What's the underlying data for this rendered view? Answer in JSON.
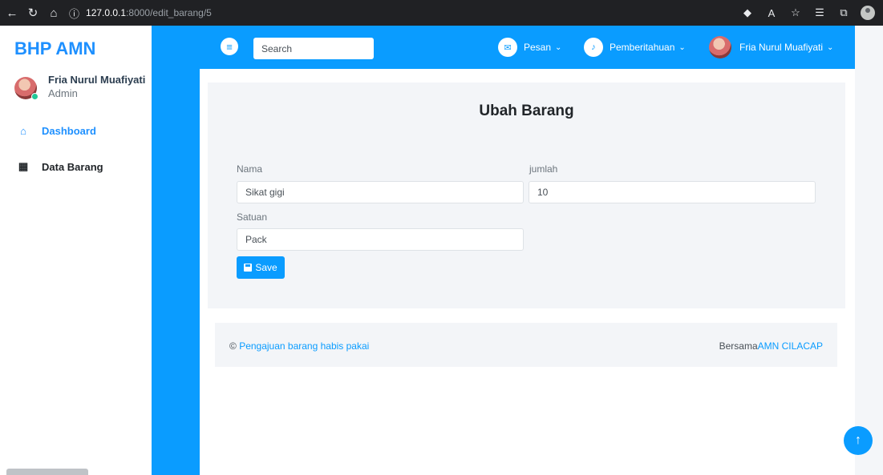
{
  "browser": {
    "back_icon": "←",
    "refresh_icon": "↻",
    "home_icon": "⌂",
    "info_icon": "ⓘ",
    "url_host": "127.0.0.1",
    "url_path": ":8000/edit_barang/5"
  },
  "sidebar": {
    "brand": "BHP AMN",
    "user_name": "Fria Nurul Muafiyati",
    "user_role": "Admin",
    "items": [
      {
        "label": "Dashboard",
        "icon": "⌂"
      },
      {
        "label": "Data Barang",
        "icon": "▦"
      }
    ]
  },
  "header": {
    "menu_icon": "≡",
    "search_placeholder": "Search",
    "messages_label": "Pesan",
    "notifications_label": "Pemberitahuan",
    "user_label": "Fria Nurul Muafiyati",
    "caret": "⌄"
  },
  "form": {
    "title": "Ubah Barang",
    "nama_label": "Nama",
    "nama_value": "Sikat gigi",
    "jumlah_label": "jumlah",
    "jumlah_value": "10",
    "satuan_label": "Satuan",
    "satuan_value": "Pack",
    "save_label": "Save"
  },
  "footer": {
    "copyright": "©",
    "left_link": "Pengajuan barang habis pakai",
    "right_text": "Bersama",
    "right_link": "AMN CILACAP"
  },
  "colors": {
    "accent": "#0a9cff",
    "brand": "#1e90ff"
  }
}
